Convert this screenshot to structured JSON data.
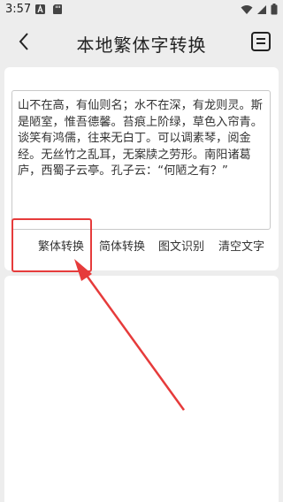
{
  "status_bar": {
    "time": "3:57"
  },
  "header": {
    "title": "本地繁体字转换"
  },
  "input": {
    "text": "山不在高，有仙则名；水不在深，有龙则灵。斯是陋室，惟吾德馨。苔痕上阶绿，草色入帘青。谈笑有鸿儒，往来无白丁。可以调素琴，阅金经。无丝竹之乱耳，无案牍之劳形。南阳诸葛庐，西蜀子云亭。孔子云：“何陋之有？”"
  },
  "actions": {
    "traditional": "繁体转换",
    "simplified": "简体转换",
    "ocr": "图文识别",
    "clear": "清空文字"
  },
  "colors": {
    "background": "#ededed",
    "card": "#ffffff",
    "annotation": "#e63b3b"
  },
  "icons": {
    "back": "back-arrow-icon",
    "menu": "list-document-icon"
  }
}
